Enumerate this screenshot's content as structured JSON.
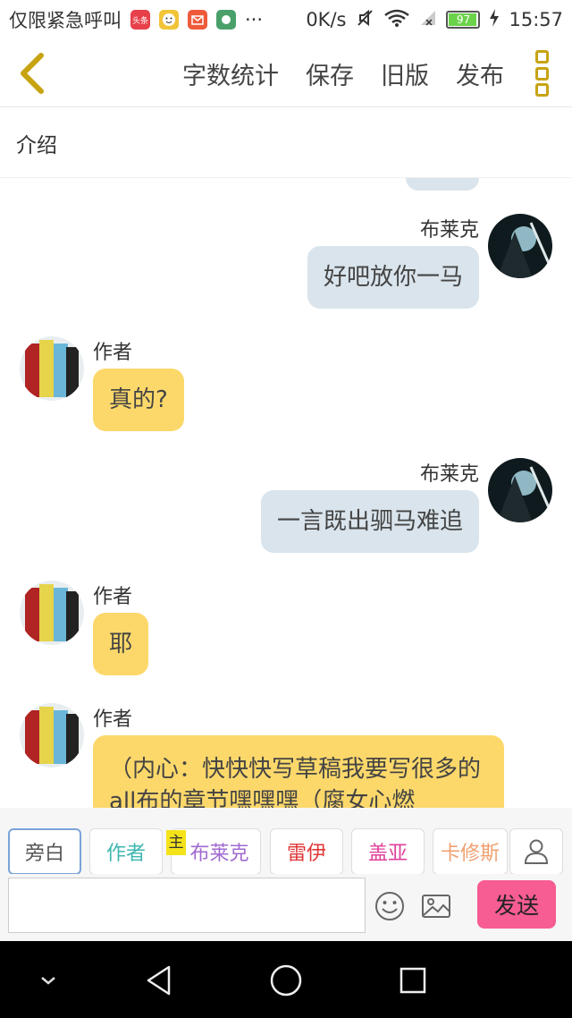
{
  "status_bar": {
    "carrier": "仅限紧急呼叫",
    "app_icons": [
      {
        "name": "toutiao-icon",
        "label": "头条",
        "color": "#e8404a"
      },
      {
        "name": "smiley-app-icon",
        "label": "",
        "color": "#f2c438"
      },
      {
        "name": "mail-app-icon",
        "label": "",
        "color": "#ee5a3a"
      },
      {
        "name": "game-app-icon",
        "label": "",
        "color": "#4aa06a"
      }
    ],
    "more": "···",
    "net_speed": "0K/s",
    "battery": 97,
    "time": "15:57"
  },
  "toolbar": {
    "actions": [
      "字数统计",
      "保存",
      "旧版",
      "发布"
    ]
  },
  "intro": {
    "label": "介绍"
  },
  "messages": [
    {
      "side": "right",
      "name": "布莱克",
      "text": "好吧放你一马"
    },
    {
      "side": "left",
      "name": "作者",
      "text": "真的?"
    },
    {
      "side": "right",
      "name": "布莱克",
      "text": "一言既出驷马难追"
    },
    {
      "side": "left",
      "name": "作者",
      "text": "耶"
    },
    {
      "side": "left",
      "name": "作者",
      "text": "（内心：快快快写草稿我要写很多的all布的章节嘿嘿嘿（腐女心燃"
    }
  ],
  "roles": [
    {
      "label": "旁白",
      "color": "#555555"
    },
    {
      "label": "作者",
      "color": "#3fb6b0"
    },
    {
      "label": "布莱克",
      "color": "#a06ad0",
      "badge": "主"
    },
    {
      "label": "雷伊",
      "color": "#e03535"
    },
    {
      "label": "盖亚",
      "color": "#e0409a"
    },
    {
      "label": "卡修斯",
      "color": "#f0a070"
    }
  ],
  "composer": {
    "input_value": "",
    "send_label": "发送"
  },
  "colors": {
    "accent": "#c7a312",
    "bubble_right": "#d9e4ec",
    "bubble_left": "#fcd86b",
    "send": "#f75c93"
  }
}
